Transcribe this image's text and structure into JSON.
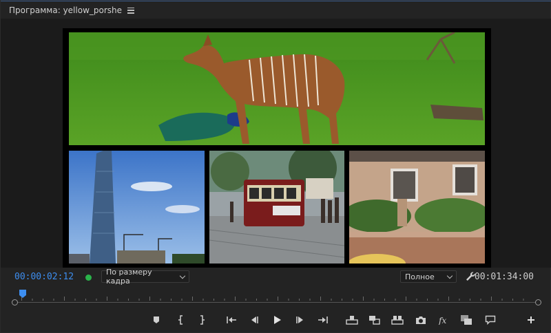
{
  "panel": {
    "title": "Программа: yellow_porshe",
    "menu_icon": "hamburger-icon"
  },
  "viewer": {
    "frame_description": "multi-camera tiles",
    "tiles": [
      {
        "name": "tile-antelope",
        "icon": "video-frame"
      },
      {
        "name": "tile-skyscraper",
        "icon": "video-frame"
      },
      {
        "name": "tile-cable-car",
        "icon": "video-frame"
      },
      {
        "name": "tile-house",
        "icon": "video-frame"
      }
    ]
  },
  "info": {
    "current_time": "00:00:02:12",
    "fit_value": "По размеру кадра",
    "quality_value": "Полное",
    "duration": "00:01:34:00",
    "status_color": "#2ab34a",
    "accent_color": "#3d8ef0"
  },
  "scrubber": {
    "playhead_position": 0.0
  },
  "transport": {
    "buttons": [
      {
        "name": "add-marker-button",
        "icon": "marker-icon"
      },
      {
        "name": "mark-in-button",
        "icon": "mark-in-icon"
      },
      {
        "name": "mark-out-button",
        "icon": "mark-out-icon"
      },
      {
        "name": "go-to-in-button",
        "icon": "go-to-in-icon"
      },
      {
        "name": "step-back-button",
        "icon": "step-back-icon"
      },
      {
        "name": "play-button",
        "icon": "play-icon"
      },
      {
        "name": "step-forward-button",
        "icon": "step-forward-icon"
      },
      {
        "name": "go-to-out-button",
        "icon": "go-to-out-icon"
      },
      {
        "name": "lift-button",
        "icon": "lift-icon"
      },
      {
        "name": "extract-button",
        "icon": "extract-icon"
      },
      {
        "name": "compare-button",
        "icon": "compare-icon"
      },
      {
        "name": "export-frame-button",
        "icon": "camera-icon"
      },
      {
        "name": "fx-button",
        "icon": "fx-icon"
      },
      {
        "name": "vr-button",
        "icon": "overlay-icon"
      },
      {
        "name": "captions-button",
        "icon": "comment-icon"
      },
      {
        "name": "button-editor-button",
        "icon": "plus-icon"
      }
    ]
  }
}
